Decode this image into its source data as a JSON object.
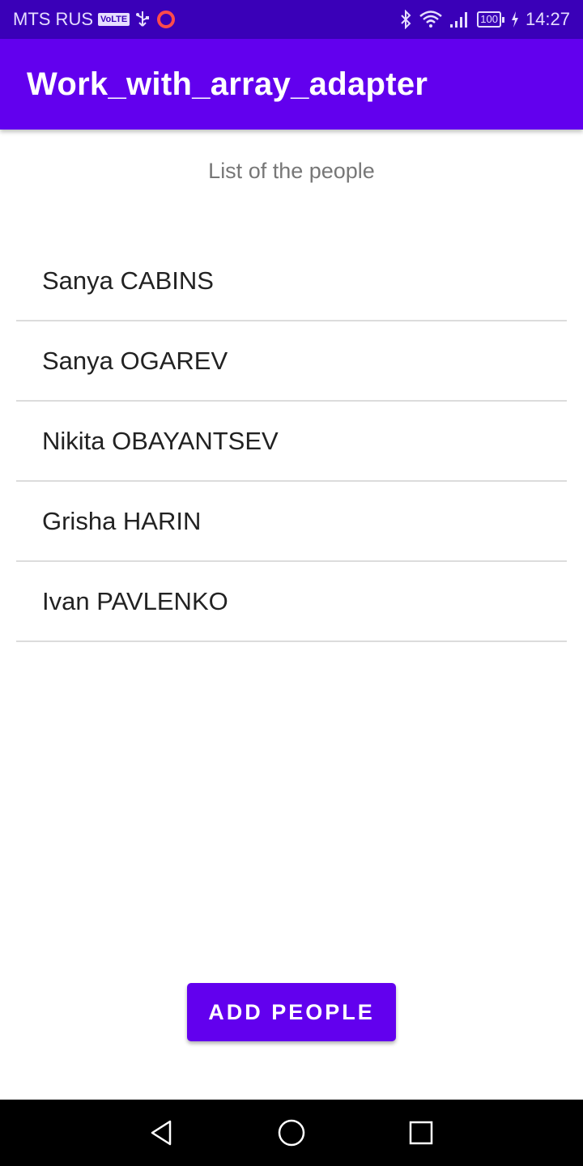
{
  "status_bar": {
    "carrier": "MTS RUS",
    "volte_badge": "VoLTE",
    "battery": "100",
    "time": "14:27",
    "icons": [
      "volte-icon",
      "usb-icon",
      "circle-notification-icon",
      "bluetooth-icon",
      "wifi-icon",
      "signal-icon",
      "battery-icon",
      "charging-icon"
    ]
  },
  "app_bar": {
    "title": "Work_with_array_adapter"
  },
  "main": {
    "header": "List of the people",
    "people": [
      "Sanya CABINS",
      "Sanya OGAREV",
      "Nikita OBAYANTSEV",
      "Grisha HARIN",
      "Ivan PAVLENKO"
    ],
    "add_button_label": "ADD PEOPLE"
  },
  "nav_bar": {
    "icons": [
      "back-icon",
      "home-icon",
      "recents-icon"
    ]
  },
  "colors": {
    "primary": "#6200ee",
    "primary_dark": "#3a00b8",
    "text": "#222222",
    "secondary_text": "#777777",
    "divider": "#dcdcdc"
  }
}
